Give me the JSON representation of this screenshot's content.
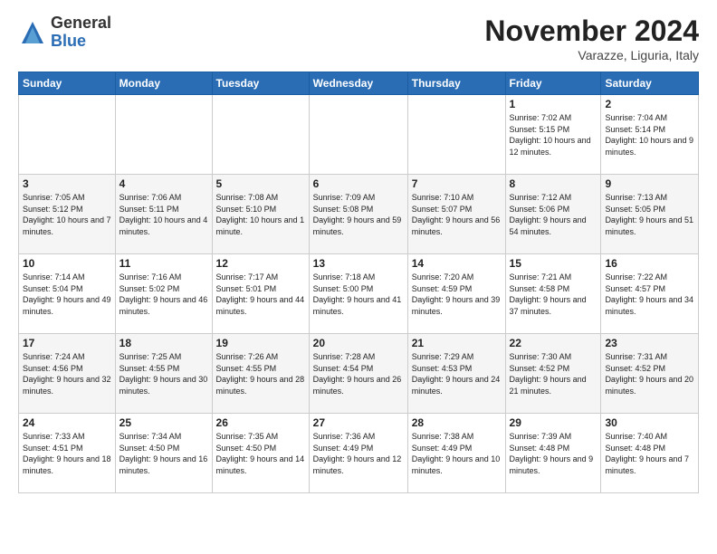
{
  "logo": {
    "general": "General",
    "blue": "Blue"
  },
  "header": {
    "month": "November 2024",
    "location": "Varazze, Liguria, Italy"
  },
  "days_of_week": [
    "Sunday",
    "Monday",
    "Tuesday",
    "Wednesday",
    "Thursday",
    "Friday",
    "Saturday"
  ],
  "weeks": [
    [
      {
        "day": "",
        "info": ""
      },
      {
        "day": "",
        "info": ""
      },
      {
        "day": "",
        "info": ""
      },
      {
        "day": "",
        "info": ""
      },
      {
        "day": "",
        "info": ""
      },
      {
        "day": "1",
        "info": "Sunrise: 7:02 AM\nSunset: 5:15 PM\nDaylight: 10 hours and 12 minutes."
      },
      {
        "day": "2",
        "info": "Sunrise: 7:04 AM\nSunset: 5:14 PM\nDaylight: 10 hours and 9 minutes."
      }
    ],
    [
      {
        "day": "3",
        "info": "Sunrise: 7:05 AM\nSunset: 5:12 PM\nDaylight: 10 hours and 7 minutes."
      },
      {
        "day": "4",
        "info": "Sunrise: 7:06 AM\nSunset: 5:11 PM\nDaylight: 10 hours and 4 minutes."
      },
      {
        "day": "5",
        "info": "Sunrise: 7:08 AM\nSunset: 5:10 PM\nDaylight: 10 hours and 1 minute."
      },
      {
        "day": "6",
        "info": "Sunrise: 7:09 AM\nSunset: 5:08 PM\nDaylight: 9 hours and 59 minutes."
      },
      {
        "day": "7",
        "info": "Sunrise: 7:10 AM\nSunset: 5:07 PM\nDaylight: 9 hours and 56 minutes."
      },
      {
        "day": "8",
        "info": "Sunrise: 7:12 AM\nSunset: 5:06 PM\nDaylight: 9 hours and 54 minutes."
      },
      {
        "day": "9",
        "info": "Sunrise: 7:13 AM\nSunset: 5:05 PM\nDaylight: 9 hours and 51 minutes."
      }
    ],
    [
      {
        "day": "10",
        "info": "Sunrise: 7:14 AM\nSunset: 5:04 PM\nDaylight: 9 hours and 49 minutes."
      },
      {
        "day": "11",
        "info": "Sunrise: 7:16 AM\nSunset: 5:02 PM\nDaylight: 9 hours and 46 minutes."
      },
      {
        "day": "12",
        "info": "Sunrise: 7:17 AM\nSunset: 5:01 PM\nDaylight: 9 hours and 44 minutes."
      },
      {
        "day": "13",
        "info": "Sunrise: 7:18 AM\nSunset: 5:00 PM\nDaylight: 9 hours and 41 minutes."
      },
      {
        "day": "14",
        "info": "Sunrise: 7:20 AM\nSunset: 4:59 PM\nDaylight: 9 hours and 39 minutes."
      },
      {
        "day": "15",
        "info": "Sunrise: 7:21 AM\nSunset: 4:58 PM\nDaylight: 9 hours and 37 minutes."
      },
      {
        "day": "16",
        "info": "Sunrise: 7:22 AM\nSunset: 4:57 PM\nDaylight: 9 hours and 34 minutes."
      }
    ],
    [
      {
        "day": "17",
        "info": "Sunrise: 7:24 AM\nSunset: 4:56 PM\nDaylight: 9 hours and 32 minutes."
      },
      {
        "day": "18",
        "info": "Sunrise: 7:25 AM\nSunset: 4:55 PM\nDaylight: 9 hours and 30 minutes."
      },
      {
        "day": "19",
        "info": "Sunrise: 7:26 AM\nSunset: 4:55 PM\nDaylight: 9 hours and 28 minutes."
      },
      {
        "day": "20",
        "info": "Sunrise: 7:28 AM\nSunset: 4:54 PM\nDaylight: 9 hours and 26 minutes."
      },
      {
        "day": "21",
        "info": "Sunrise: 7:29 AM\nSunset: 4:53 PM\nDaylight: 9 hours and 24 minutes."
      },
      {
        "day": "22",
        "info": "Sunrise: 7:30 AM\nSunset: 4:52 PM\nDaylight: 9 hours and 21 minutes."
      },
      {
        "day": "23",
        "info": "Sunrise: 7:31 AM\nSunset: 4:52 PM\nDaylight: 9 hours and 20 minutes."
      }
    ],
    [
      {
        "day": "24",
        "info": "Sunrise: 7:33 AM\nSunset: 4:51 PM\nDaylight: 9 hours and 18 minutes."
      },
      {
        "day": "25",
        "info": "Sunrise: 7:34 AM\nSunset: 4:50 PM\nDaylight: 9 hours and 16 minutes."
      },
      {
        "day": "26",
        "info": "Sunrise: 7:35 AM\nSunset: 4:50 PM\nDaylight: 9 hours and 14 minutes."
      },
      {
        "day": "27",
        "info": "Sunrise: 7:36 AM\nSunset: 4:49 PM\nDaylight: 9 hours and 12 minutes."
      },
      {
        "day": "28",
        "info": "Sunrise: 7:38 AM\nSunset: 4:49 PM\nDaylight: 9 hours and 10 minutes."
      },
      {
        "day": "29",
        "info": "Sunrise: 7:39 AM\nSunset: 4:48 PM\nDaylight: 9 hours and 9 minutes."
      },
      {
        "day": "30",
        "info": "Sunrise: 7:40 AM\nSunset: 4:48 PM\nDaylight: 9 hours and 7 minutes."
      }
    ]
  ]
}
